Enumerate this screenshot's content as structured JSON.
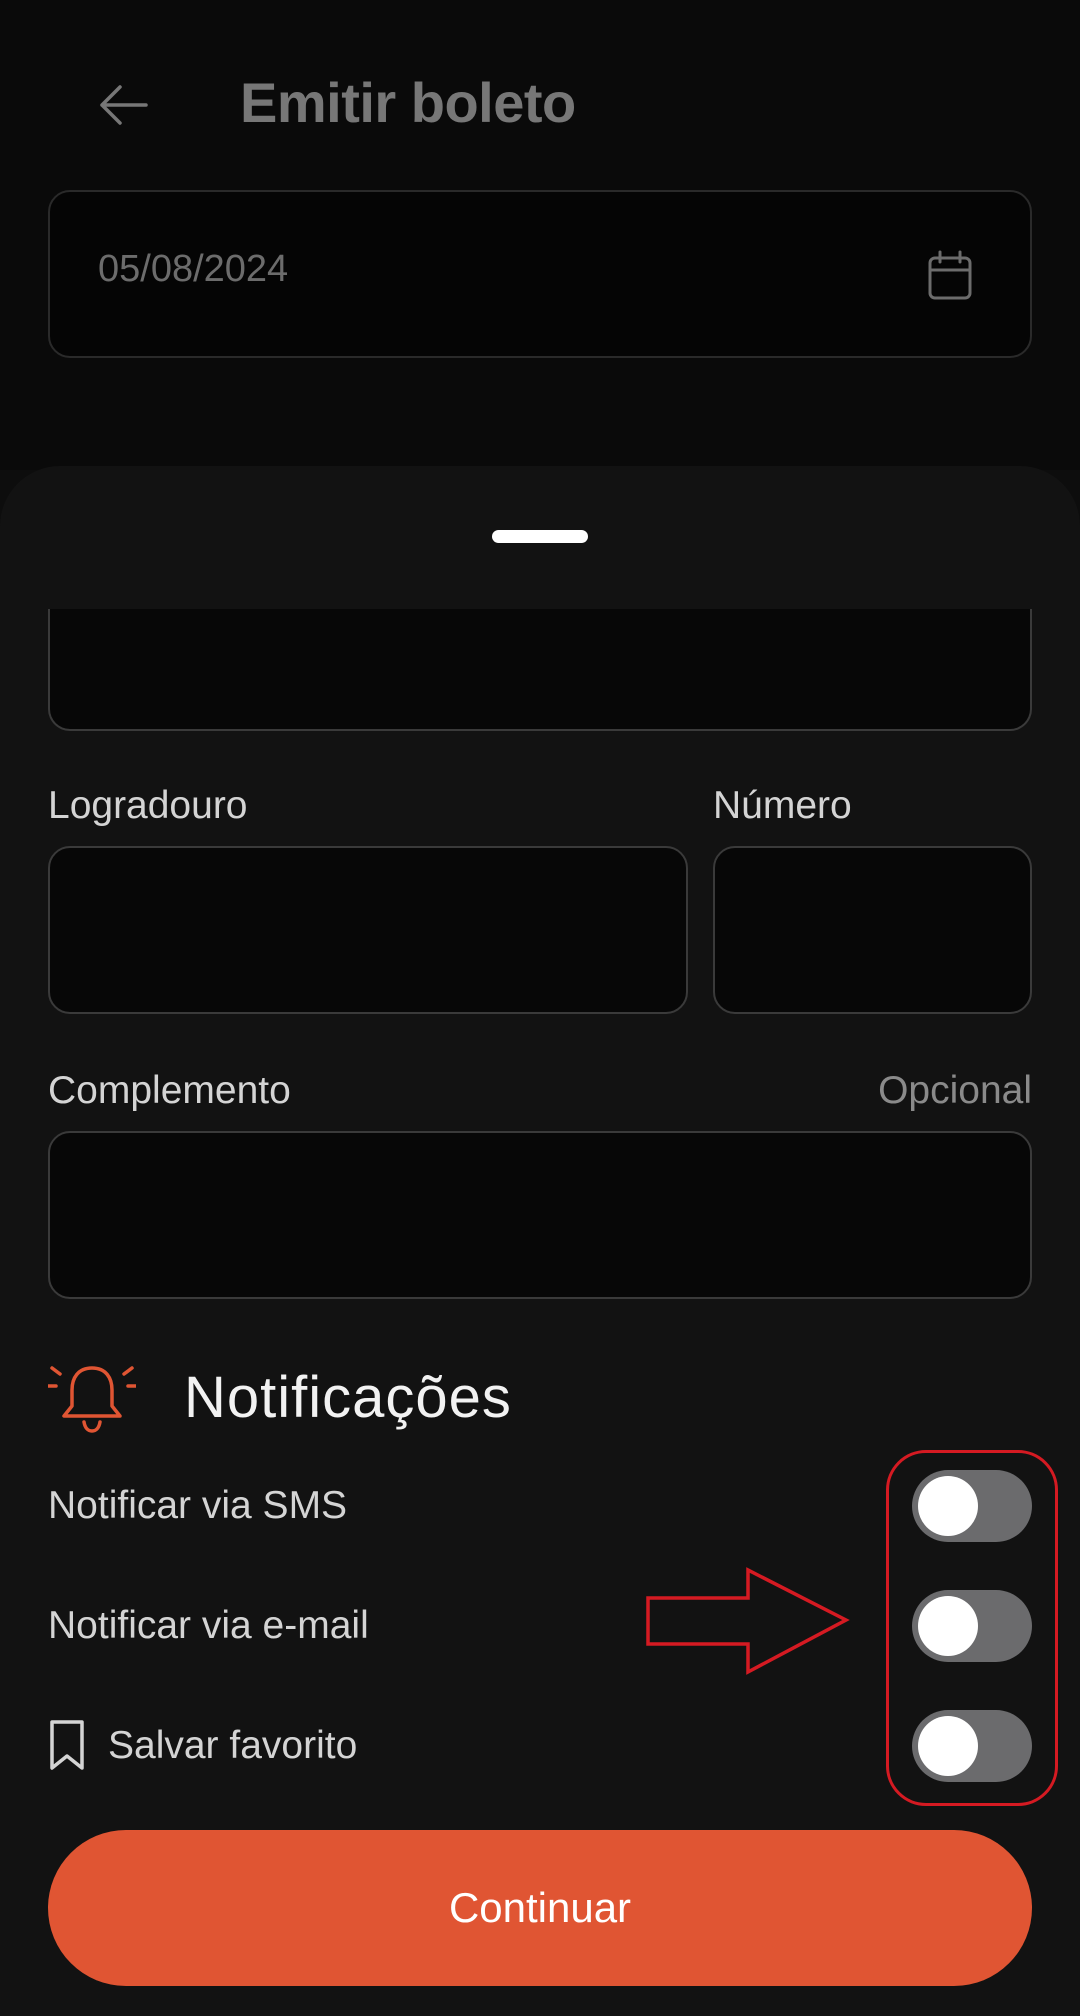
{
  "header": {
    "title": "Emitir boleto",
    "back_icon": "arrow-left-icon"
  },
  "date_field": {
    "value": "05/08/2024",
    "icon": "calendar-icon"
  },
  "form": {
    "logradouro_label": "Logradouro",
    "numero_label": "Número",
    "complemento_label": "Complemento",
    "complemento_hint": "Opcional"
  },
  "notifications": {
    "title": "Notificações",
    "icon": "bell-icon",
    "accent_color": "#e05533",
    "toggles": [
      {
        "label": "Notificar via SMS",
        "on": false
      },
      {
        "label": "Notificar via e-mail",
        "on": false
      },
      {
        "label": "Salvar favorito",
        "on": false,
        "icon": "bookmark-icon"
      }
    ]
  },
  "footer": {
    "continue_label": "Continuar",
    "button_color": "#e05533"
  },
  "annotation": {
    "color": "#d51a22"
  }
}
